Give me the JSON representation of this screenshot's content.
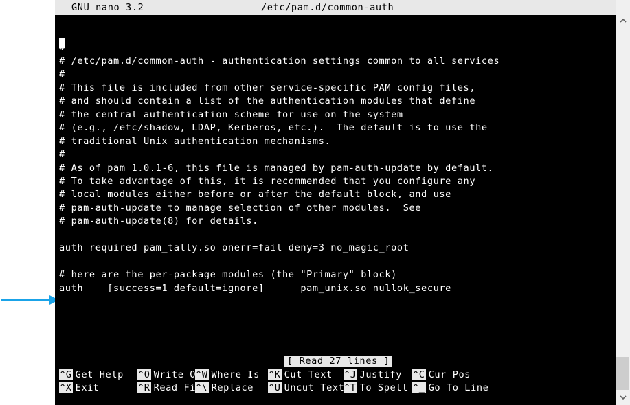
{
  "title_bar": {
    "app": "GNU nano 3.2",
    "file": "/etc/pam.d/common-auth"
  },
  "lines": [
    "",
    "#",
    "# /etc/pam.d/common-auth - authentication settings common to all services",
    "#",
    "# This file is included from other service-specific PAM config files,",
    "# and should contain a list of the authentication modules that define",
    "# the central authentication scheme for use on the system",
    "# (e.g., /etc/shadow, LDAP, Kerberos, etc.).  The default is to use the",
    "# traditional Unix authentication mechanisms.",
    "#",
    "# As of pam 1.0.1-6, this file is managed by pam-auth-update by default.",
    "# To take advantage of this, it is recommended that you configure any",
    "# local modules either before or after the default block, and use",
    "# pam-auth-update to manage selection of other modules.  See",
    "# pam-auth-update(8) for details.",
    "",
    "auth required pam_tally.so onerr=fail deny=3 no_magic_root",
    "",
    "# here are the per-package modules (the \"Primary\" block)",
    "auth    [success=1 default=ignore]      pam_unix.so nullok_secure"
  ],
  "status": "[ Read 27 lines ]",
  "shortcuts": [
    [
      {
        "key": "^G",
        "label": "Get Help"
      },
      {
        "key": "^O",
        "label": "Write Out"
      },
      {
        "key": "^W",
        "label": "Where Is"
      },
      {
        "key": "^K",
        "label": "Cut Text"
      },
      {
        "key": "^J",
        "label": "Justify"
      },
      {
        "key": "^C",
        "label": "Cur Pos"
      }
    ],
    [
      {
        "key": "^X",
        "label": "Exit"
      },
      {
        "key": "^R",
        "label": "Read File"
      },
      {
        "key": "^\\",
        "label": "Replace"
      },
      {
        "key": "^U",
        "label": "Uncut Text"
      },
      {
        "key": "^T",
        "label": "To Spell"
      },
      {
        "key": "^_",
        "label": "Go To Line"
      }
    ]
  ],
  "colors": {
    "terminal_bg": "#000000",
    "terminal_fg": "#ffffff",
    "highlight_bg": "#e8e8e8",
    "arrow": "#1aa3e8"
  },
  "icons": {
    "scroll_up": "chevron-up-icon",
    "scroll_down": "chevron-down-icon",
    "annotation": "arrow-right-icon"
  }
}
